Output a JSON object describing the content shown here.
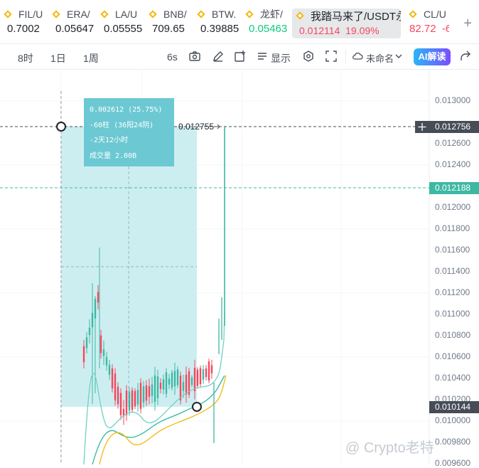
{
  "tickers": [
    {
      "symbol": "FIL/U",
      "price": "0.7002",
      "color": "#1e2329"
    },
    {
      "symbol": "ERA/",
      "price": "0.05647",
      "color": "#1e2329"
    },
    {
      "symbol": "LA/U",
      "price": "0.05555",
      "color": "#1e2329"
    },
    {
      "symbol": "BNB/",
      "price": "709.65",
      "color": "#1e2329"
    },
    {
      "symbol": "BTW.",
      "price": "0.39885",
      "color": "#1e2329"
    },
    {
      "symbol": "龙虾/",
      "price": "0.05463",
      "color": "#0ecb81"
    }
  ],
  "active_ticker": {
    "symbol": "我踏马来了/USDT永",
    "price": "0.012114",
    "change": "19.09%"
  },
  "last_ticker": {
    "symbol": "CL/U",
    "price": "82.72",
    "change": "-6"
  },
  "toolbar": {
    "timeframes": [
      "8时",
      "1日",
      "1周"
    ],
    "interval": "6s",
    "display_label": "显示",
    "layout_name": "未命名",
    "ai_label": "AI解读"
  },
  "chart": {
    "price_axis": [
      "0.013000",
      "0.012600",
      "0.012400",
      "0.012000",
      "0.011800",
      "0.011600",
      "0.011400",
      "0.011200",
      "0.011000",
      "0.010800",
      "0.010600",
      "0.010400",
      "0.010200",
      "0.010000",
      "0.009800",
      "0.009600"
    ],
    "tags": {
      "top": "0.012756",
      "current": "0.012188",
      "low": "0.010144"
    },
    "marker_label": "0.012755",
    "info": {
      "line1": "0.002612 (25.75%)",
      "line2": "-60柱 (36阳24阴)",
      "line3": "-2天12小时",
      "line4": "成交量 2.00B"
    },
    "watermark": "@ Crypto老特"
  },
  "colors": {
    "up": "#0ecb81",
    "down": "#f6465d",
    "accent": "#29b6f6"
  }
}
